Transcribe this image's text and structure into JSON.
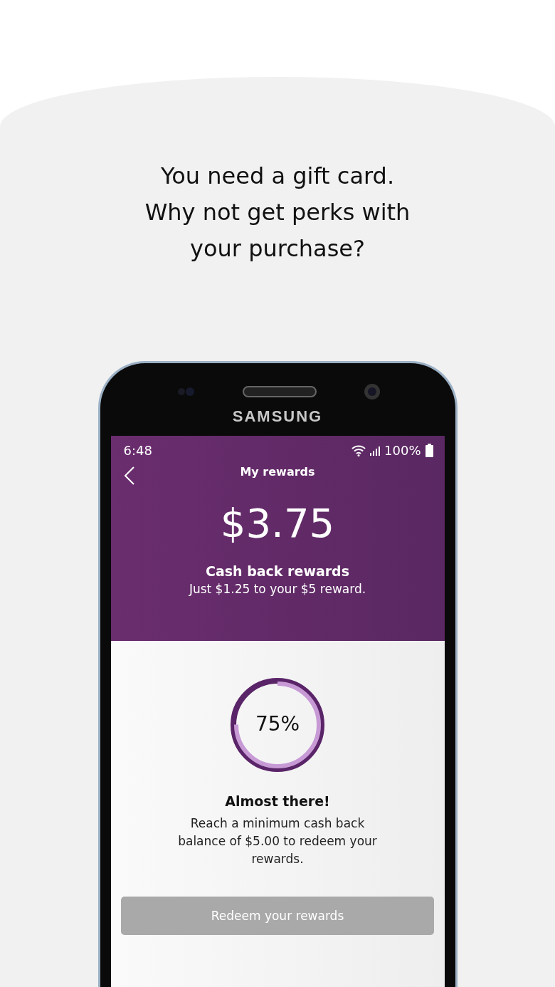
{
  "headline": "You need a gift card.\nWhy not get perks with\nyour purchase?",
  "phone": {
    "brand": "SAMSUNG"
  },
  "status_bar": {
    "time": "6:48",
    "battery": "100%"
  },
  "header": {
    "title": "My rewards",
    "amount": "$3.75",
    "subtitle": "Cash back rewards",
    "note": "Just $1.25 to your $5 reward."
  },
  "progress": {
    "level": 0.75,
    "reading": "75%"
  },
  "message": {
    "title": "Almost there!",
    "body": "Reach a minimum cash back balance of $5.00 to redeem your rewards."
  },
  "button": {
    "label": "Redeem your rewards",
    "disabled": true
  }
}
